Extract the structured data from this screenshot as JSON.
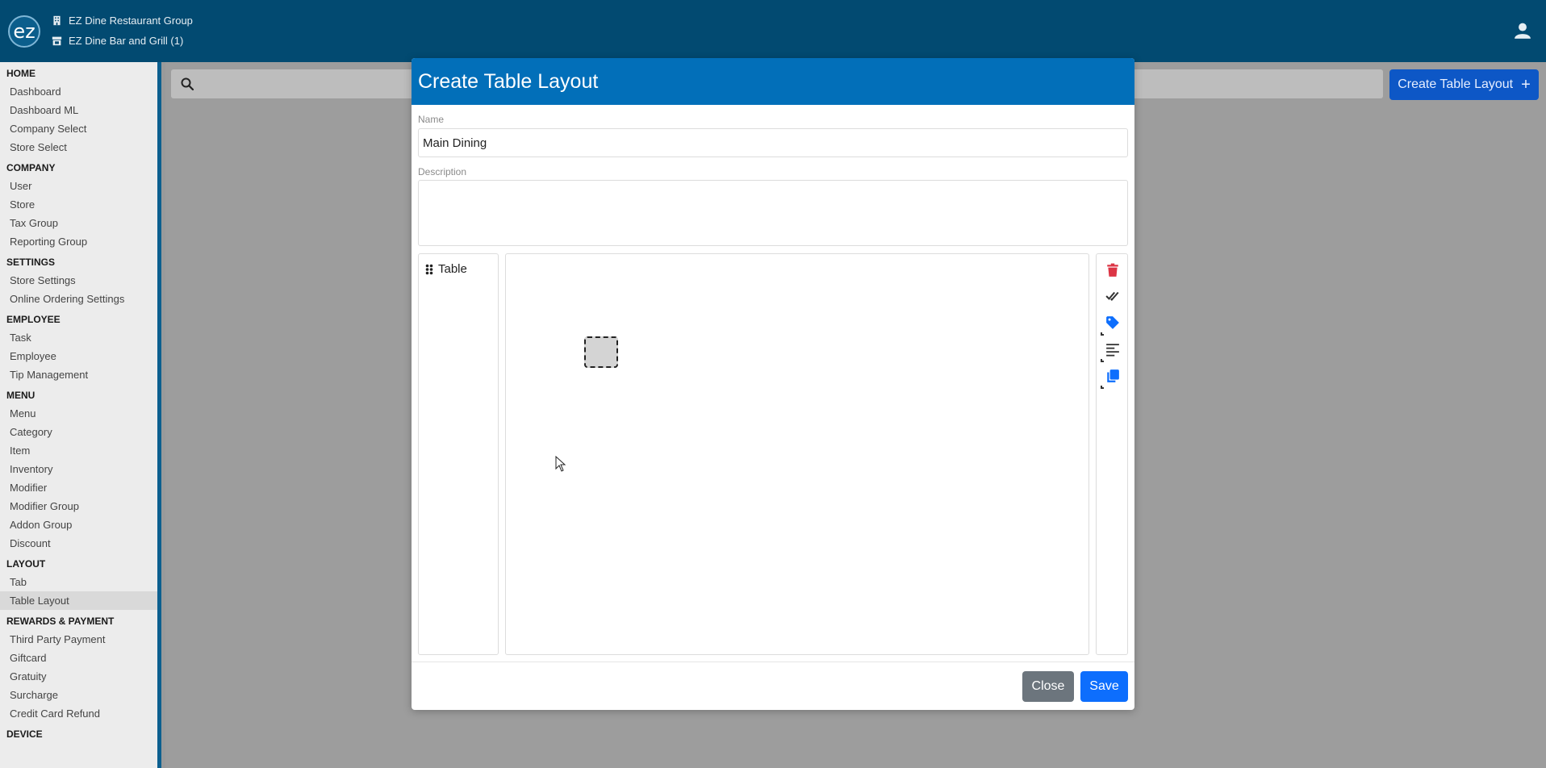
{
  "app": {
    "logo_text": "ez"
  },
  "header": {
    "company": "EZ Dine Restaurant Group",
    "store": "EZ Dine Bar and Grill (1)"
  },
  "sidebar": {
    "sections": [
      {
        "title": "HOME",
        "items": [
          "Dashboard",
          "Dashboard ML",
          "Company Select",
          "Store Select"
        ]
      },
      {
        "title": "COMPANY",
        "items": [
          "User",
          "Store",
          "Tax Group",
          "Reporting Group"
        ]
      },
      {
        "title": "SETTINGS",
        "items": [
          "Store Settings",
          "Online Ordering Settings"
        ]
      },
      {
        "title": "EMPLOYEE",
        "items": [
          "Task",
          "Employee",
          "Tip Management"
        ]
      },
      {
        "title": "MENU",
        "items": [
          "Menu",
          "Category",
          "Item",
          "Inventory",
          "Modifier",
          "Modifier Group",
          "Addon Group",
          "Discount"
        ]
      },
      {
        "title": "LAYOUT",
        "items": [
          "Tab",
          "Table Layout"
        ]
      },
      {
        "title": "REWARDS & PAYMENT",
        "items": [
          "Third Party Payment",
          "Giftcard",
          "Gratuity",
          "Surcharge",
          "Credit Card Refund"
        ]
      },
      {
        "title": "DEVICE",
        "items": []
      }
    ],
    "active_item": "Table Layout"
  },
  "toolbar": {
    "search_placeholder": "",
    "create_label": "Create Table Layout",
    "create_icon": "+"
  },
  "modal": {
    "title": "Create Table Layout",
    "name_label": "Name",
    "name_value": "Main Dining",
    "description_label": "Description",
    "description_value": "",
    "palette": {
      "item_label": "Table"
    },
    "close_label": "Close",
    "save_label": "Save"
  },
  "colors": {
    "topbar": "#024a71",
    "modal_header": "#026fb9",
    "primary": "#0d6efd",
    "secondary": "#6c757d",
    "danger": "#dc3545",
    "tag": "#0d6efd"
  }
}
